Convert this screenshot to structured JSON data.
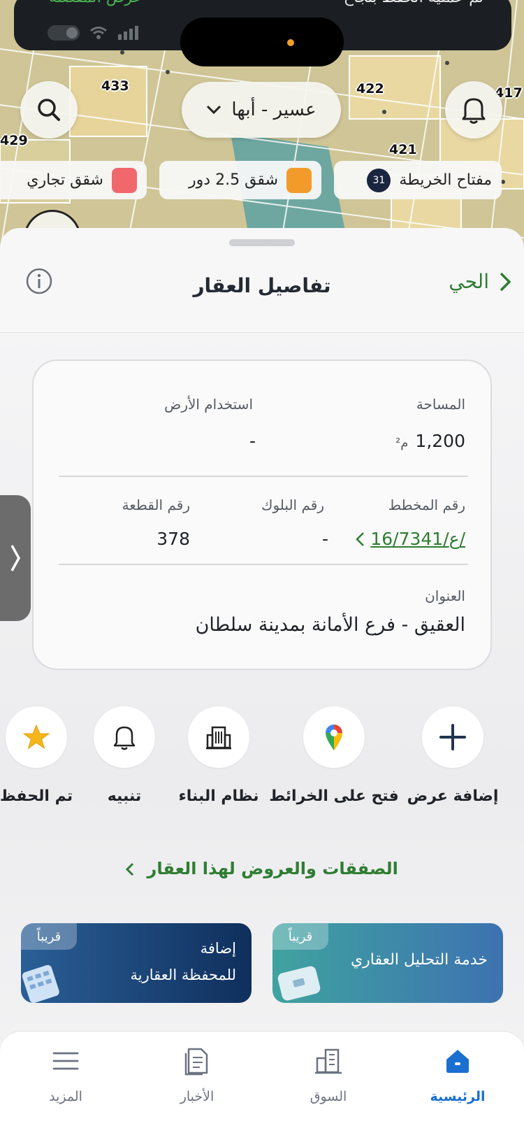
{
  "status_toast": {
    "message": "تم عملية الحفظ بنجاح",
    "action_label": "عرض المفضلة"
  },
  "map": {
    "region_selector": "عسير - أبها",
    "plot_numbers": [
      "433",
      "422",
      "417",
      "429",
      "421"
    ],
    "legend_chips": [
      {
        "label": "مفتاح الخريطة",
        "badge": "31"
      },
      {
        "label": "شقق 2.5 دور",
        "color": "#f29b2b"
      },
      {
        "label": "شقق تجاري",
        "color": "#f0686c"
      }
    ]
  },
  "sheet": {
    "title": "تفاصيل العقار",
    "back_label": "الحي"
  },
  "details": {
    "area_label": "المساحة",
    "area_value": "1,200",
    "area_unit": "م²",
    "land_use_label": "استخدام الأرض",
    "land_use_value": "-",
    "plan_label": "رقم المخطط",
    "plan_value": "16/7341/ع/",
    "block_label": "رقم البلوك",
    "block_value": "-",
    "plot_label": "رقم القطعة",
    "plot_value": "378",
    "address_label": "العنوان",
    "address_value": "العقيق - فرع الأمانة بمدينة سلطان"
  },
  "actions": [
    {
      "label": "إضافة عرض",
      "icon": "plus-icon"
    },
    {
      "label": "فتح على الخرائط",
      "icon": "google-maps-icon"
    },
    {
      "label": "نظام البناء",
      "icon": "building-icon"
    },
    {
      "label": "تنبيه",
      "icon": "bell-icon"
    },
    {
      "label": "تم الحفظ",
      "icon": "star-icon"
    }
  ],
  "deals_link": "الصفقات والعروض لهذا العقار",
  "promos": [
    {
      "tag": "قريباً",
      "text": "خدمة التحليل العقاري"
    },
    {
      "tag": "قريباً",
      "line1": "إضافة",
      "line2": "للمحفظة العقارية"
    }
  ],
  "bottom_nav": [
    {
      "label": "الرئيسية",
      "icon": "home-icon",
      "active": true
    },
    {
      "label": "السوق",
      "icon": "market-icon"
    },
    {
      "label": "الأخبار",
      "icon": "news-icon"
    },
    {
      "label": "المزيد",
      "icon": "menu-icon"
    }
  ],
  "colors": {
    "brand_green": "#2e7d32",
    "nav_active": "#1a6fd1",
    "promo_teal": "#3fa0a0",
    "promo_navy": "#123a6b"
  }
}
